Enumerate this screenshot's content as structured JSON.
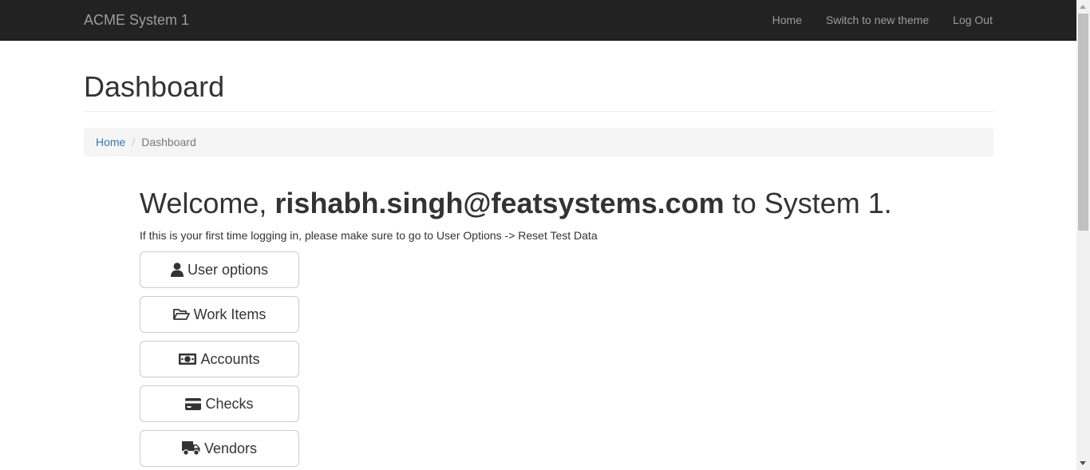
{
  "navbar": {
    "brand": "ACME System 1",
    "links": [
      {
        "label": "Home"
      },
      {
        "label": "Switch to new theme"
      },
      {
        "label": "Log Out"
      }
    ]
  },
  "page": {
    "title": "Dashboard"
  },
  "breadcrumb": {
    "home": "Home",
    "separator": "/",
    "current": "Dashboard"
  },
  "welcome": {
    "prefix": "Welcome,",
    "user": "rishabh.singh@featsystems.com",
    "suffix": "to System 1.",
    "note": "If this is your first time logging in, please make sure to go to User Options -> Reset Test Data"
  },
  "menu": [
    {
      "label": "User options",
      "icon": "user-icon"
    },
    {
      "label": "Work Items",
      "icon": "folder-open-icon"
    },
    {
      "label": "Accounts",
      "icon": "money-icon"
    },
    {
      "label": "Checks",
      "icon": "credit-card-icon"
    },
    {
      "label": "Vendors",
      "icon": "truck-icon"
    }
  ]
}
